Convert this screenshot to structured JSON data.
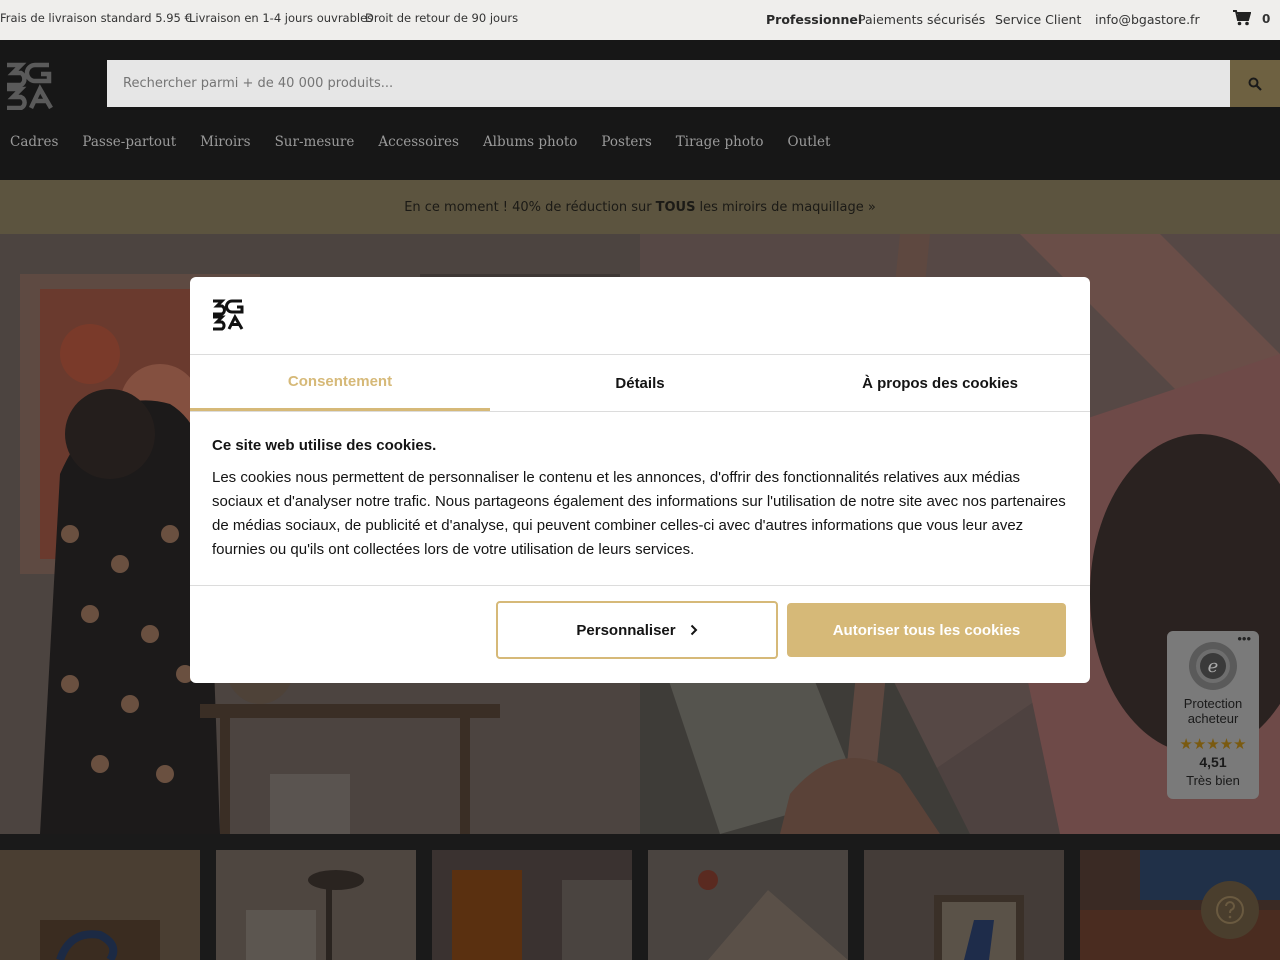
{
  "topbar": {
    "shipping": "Frais de livraison standard 5.95 €",
    "delivery": "Livraison en 1-4 jours ouvrables",
    "returns": "Droit de retour de 90 jours",
    "professional": "Professionnel",
    "payments": "Paiements sécurisés",
    "service": "Service Client",
    "email": "info@bgastore.fr",
    "cart_count": "0"
  },
  "header": {
    "search_placeholder": "Rechercher parmi + de 40 000 produits...",
    "nav": [
      "Cadres",
      "Passe-partout",
      "Miroirs",
      "Sur-mesure",
      "Accessoires",
      "Albums photo",
      "Posters",
      "Tirage photo",
      "Outlet"
    ]
  },
  "promo": {
    "before": "En ce moment ! 40% de réduction sur",
    "bold": "TOUS",
    "after": "les miroirs de maquillage »"
  },
  "cookie": {
    "tabs": [
      "Consentement",
      "Détails",
      "À propos des cookies"
    ],
    "title": "Ce site web utilise des cookies.",
    "body": "Les cookies nous permettent de personnaliser le contenu et les annonces, d'offrir des fonctionnalités relatives aux médias sociaux et d'analyser notre trafic. Nous partageons également des informations sur l'utilisation de notre site avec nos partenaires de médias sociaux, de publicité et d'analyse, qui peuvent combiner celles-ci avec d'autres informations que vous leur avez fournies ou qu'ils ont collectées lors de votre utilisation de leurs services.",
    "customize": "Personnaliser",
    "allow": "Autoriser tous les cookies"
  },
  "trusted": {
    "label": "Protection acheteur",
    "stars": "★★★★★",
    "score": "4,51",
    "rating_text": "Très bien"
  },
  "colors": {
    "accent": "#d6b978",
    "header_bg": "#171717",
    "promo_bg": "#5c543f"
  }
}
